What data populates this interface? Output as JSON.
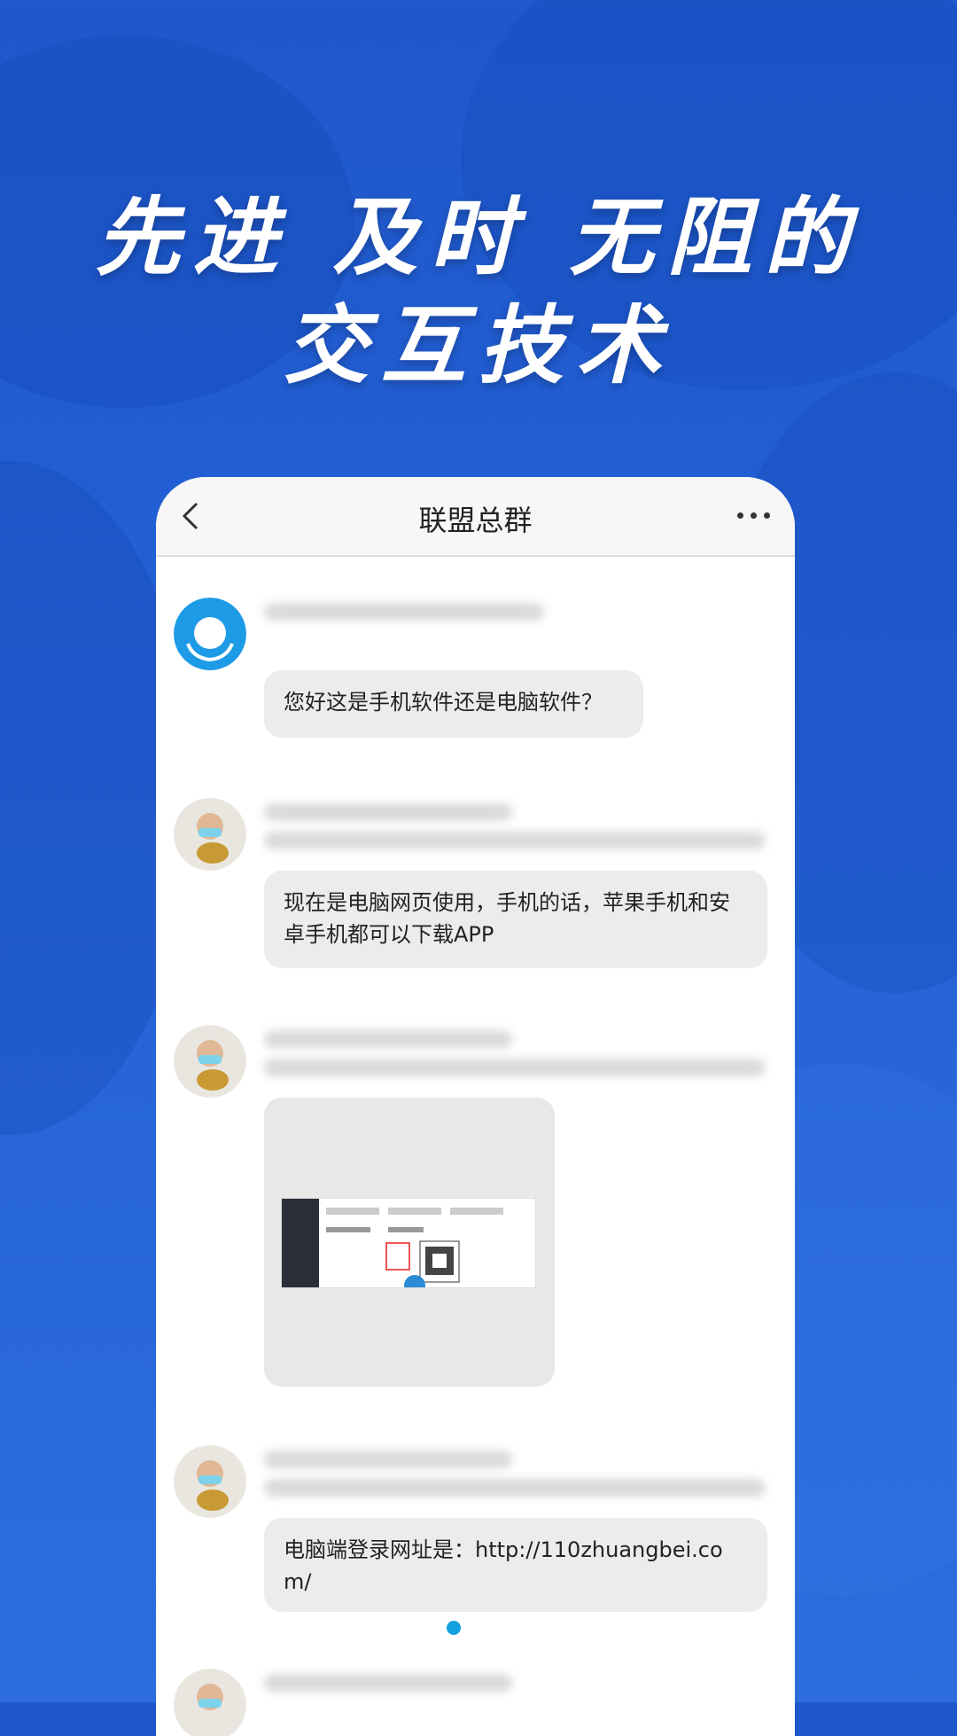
{
  "headline": {
    "line1": "先进 及时 无阻的",
    "line2": "交互技术"
  },
  "chat": {
    "title": "联盟总群",
    "messages": [
      {
        "text": "您好这是手机软件还是电脑软件？"
      },
      {
        "text": "现在是电脑网页使用，手机的话，苹果手机和安卓手机都可以下载APP"
      },
      {
        "image": "screenshot-thumbnail"
      },
      {
        "text": "电脑端登录网址是：http://110zhuangbei.com/"
      }
    ]
  },
  "colors": {
    "background": "#2360d6",
    "bubble": "#ececec",
    "accent": "#12a0e0"
  },
  "icons": [
    "back-arrow-icon",
    "more-dots-icon"
  ]
}
